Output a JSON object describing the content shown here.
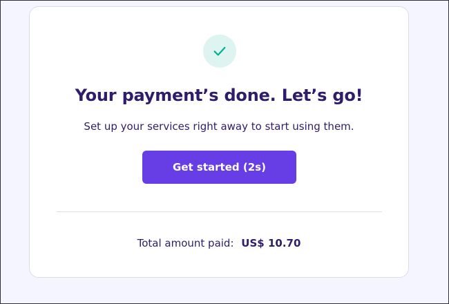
{
  "card": {
    "title": "Your payment’s done. Let’s go!",
    "subtitle": "Set up your services right away to start using them.",
    "cta_label": "Get started (2s)",
    "total_label": "Total amount paid:",
    "total_amount": "US$ 10.70",
    "icon": "check-icon"
  },
  "colors": {
    "page_background": "#f4f5ff",
    "card_background": "#ffffff",
    "text_primary": "#2f1c6a",
    "button_primary": "#673de6",
    "check_badge_bg": "#def4f0",
    "check_mark": "#00b090"
  }
}
